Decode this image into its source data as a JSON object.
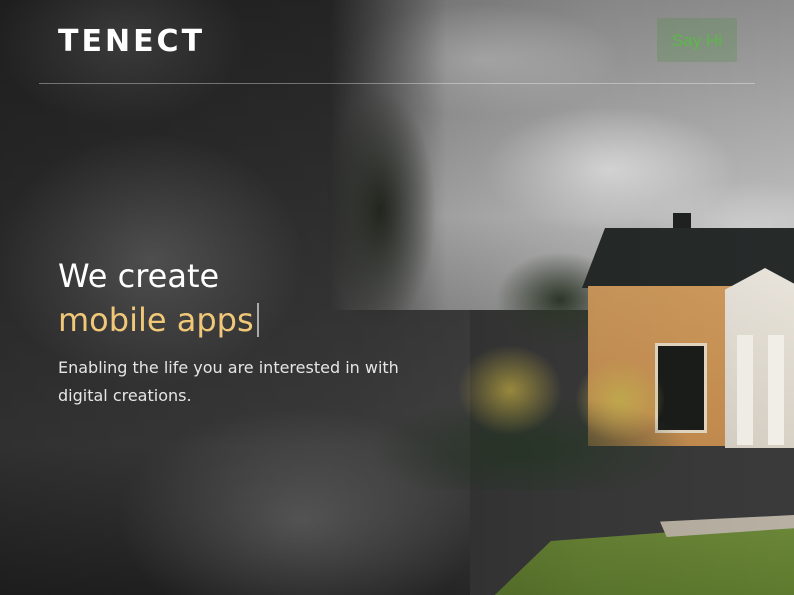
{
  "header": {
    "logo_text": "TENECT",
    "cta_label": "Say Hi"
  },
  "hero": {
    "headline_line1": "We create",
    "headline_line2": "mobile apps",
    "subtext": "Enabling the life you are interested in with digital creations."
  },
  "colors": {
    "accent": "#f0c878",
    "cta_text": "#5cb84a",
    "text": "#ffffff"
  }
}
